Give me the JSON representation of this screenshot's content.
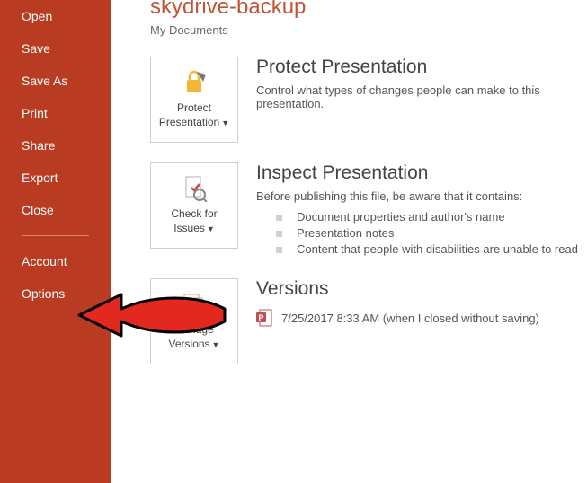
{
  "sidebar": {
    "items": [
      {
        "label": "Open"
      },
      {
        "label": "Save"
      },
      {
        "label": "Save As"
      },
      {
        "label": "Print"
      },
      {
        "label": "Share"
      },
      {
        "label": "Export"
      },
      {
        "label": "Close"
      }
    ],
    "items2": [
      {
        "label": "Account"
      },
      {
        "label": "Options"
      }
    ]
  },
  "main": {
    "title": "skydrive-backup",
    "subtitle": "My Documents",
    "protect": {
      "tile_line1": "Protect",
      "tile_line2": "Presentation",
      "heading": "Protect Presentation",
      "desc": "Control what types of changes people can make to this presentation."
    },
    "inspect": {
      "tile_line1": "Check for",
      "tile_line2": "Issues",
      "heading": "Inspect Presentation",
      "desc": "Before publishing this file, be aware that it contains:",
      "bullets": [
        "Document properties and author's name",
        "Presentation notes",
        "Content that people with disabilities are unable to read"
      ]
    },
    "versions": {
      "tile_line1": "Manage",
      "tile_line2": "Versions",
      "heading": "Versions",
      "entry": "7/25/2017 8:33 AM (when I closed without saving)"
    }
  },
  "colors": {
    "accent": "#b93b22"
  }
}
